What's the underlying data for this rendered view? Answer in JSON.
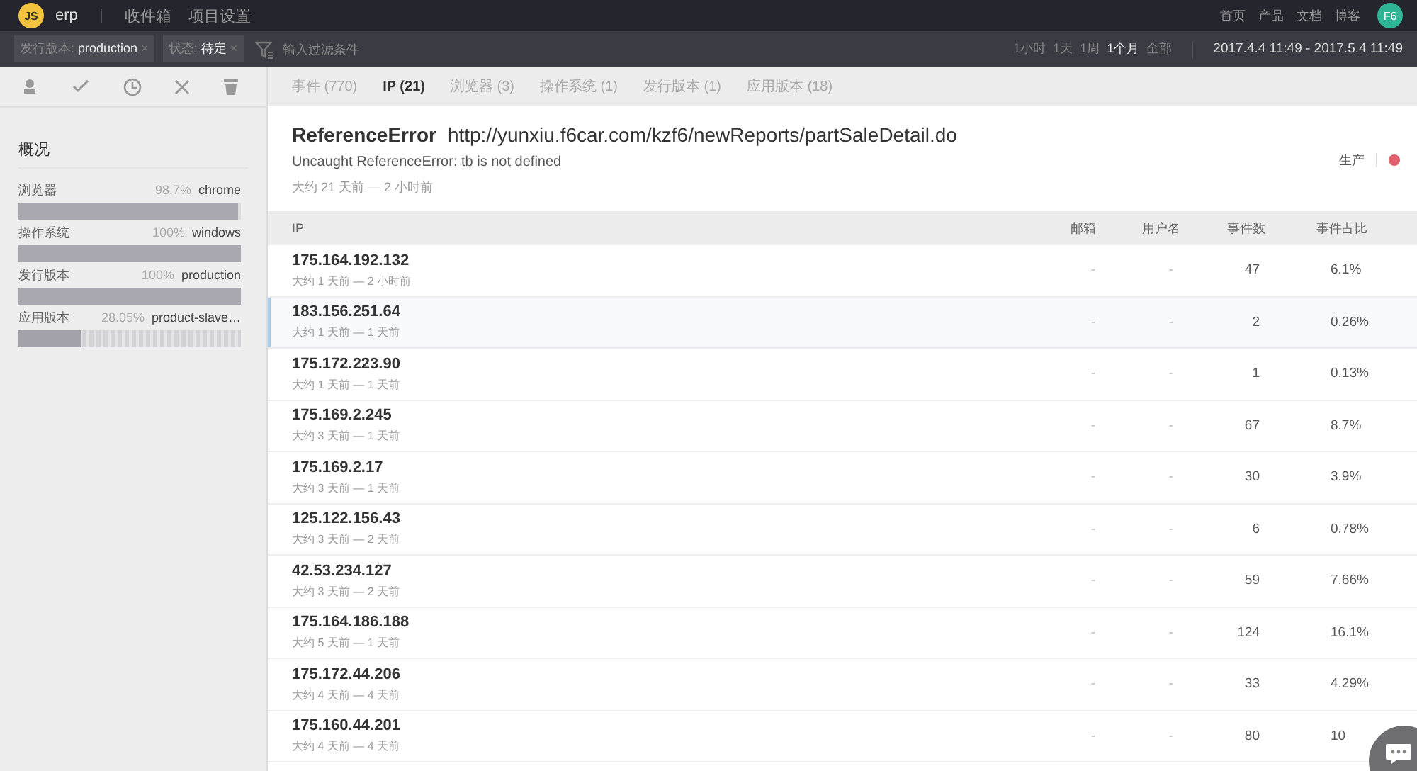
{
  "topbar": {
    "logo": "JS",
    "project": "erp",
    "nav": [
      "收件箱",
      "项目设置"
    ],
    "links": [
      "首页",
      "产品",
      "文档",
      "博客"
    ],
    "avatar": "F6"
  },
  "filterbar": {
    "chips": [
      {
        "label": "发行版本:",
        "value": "production",
        "remove": "×"
      },
      {
        "label": "状态:",
        "value": "待定",
        "remove": "×"
      }
    ],
    "placeholder": "输入过滤条件",
    "ranges": [
      {
        "label": "1小时",
        "selected": false
      },
      {
        "label": "1天",
        "selected": false
      },
      {
        "label": "1周",
        "selected": false
      },
      {
        "label": "1个月",
        "selected": true
      },
      {
        "label": "全部",
        "selected": false
      }
    ],
    "date_range": "2017.4.4 11:49 - 2017.5.4 11:49"
  },
  "sidebar": {
    "title": "概况",
    "stats": [
      {
        "name": "浏览器",
        "percent": "98.7%",
        "value": "chrome",
        "kind": "solid",
        "level": 0.987
      },
      {
        "name": "操作系统",
        "percent": "100%",
        "value": "windows",
        "kind": "solid",
        "level": 1
      },
      {
        "name": "发行版本",
        "percent": "100%",
        "value": "production",
        "kind": "solid",
        "level": 1
      },
      {
        "name": "应用版本",
        "percent": "28.05%",
        "value": "product-slave…",
        "kind": "segmented",
        "level": 0.2805
      }
    ]
  },
  "tabs": [
    {
      "label": "事件 (770)",
      "selected": false
    },
    {
      "label": "IP (21)",
      "selected": true
    },
    {
      "label": "浏览器 (3)",
      "selected": false
    },
    {
      "label": "操作系统 (1)",
      "selected": false
    },
    {
      "label": "发行版本 (1)",
      "selected": false
    },
    {
      "label": "应用版本 (18)",
      "selected": false
    }
  ],
  "issue": {
    "type": "ReferenceError",
    "url": "http://yunxiu.f6car.com/kzf6/newReports/partSaleDetail.do",
    "message": "Uncaught ReferenceError: tb is not defined",
    "time": "大约 21 天前 — 2 小时前",
    "environment": "生产",
    "color": "#e0606e"
  },
  "table": {
    "columns": [
      "IP",
      "邮箱",
      "用户名",
      "事件数",
      "事件占比"
    ],
    "rows": [
      {
        "ip": "175.164.192.132",
        "time": "大约 1 天前 — 2 小时前",
        "email": "-",
        "user": "-",
        "count": "47",
        "share": "6.1%",
        "selected": false
      },
      {
        "ip": "183.156.251.64",
        "time": "大约 1 天前 — 1 天前",
        "email": "-",
        "user": "-",
        "count": "2",
        "share": "0.26%",
        "selected": true
      },
      {
        "ip": "175.172.223.90",
        "time": "大约 1 天前 — 1 天前",
        "email": "-",
        "user": "-",
        "count": "1",
        "share": "0.13%",
        "selected": false
      },
      {
        "ip": "175.169.2.245",
        "time": "大约 3 天前 — 1 天前",
        "email": "-",
        "user": "-",
        "count": "67",
        "share": "8.7%",
        "selected": false
      },
      {
        "ip": "175.169.2.17",
        "time": "大约 3 天前 — 1 天前",
        "email": "-",
        "user": "-",
        "count": "30",
        "share": "3.9%",
        "selected": false
      },
      {
        "ip": "125.122.156.43",
        "time": "大约 3 天前 — 2 天前",
        "email": "-",
        "user": "-",
        "count": "6",
        "share": "0.78%",
        "selected": false
      },
      {
        "ip": "42.53.234.127",
        "time": "大约 3 天前 — 2 天前",
        "email": "-",
        "user": "-",
        "count": "59",
        "share": "7.66%",
        "selected": false
      },
      {
        "ip": "175.164.186.188",
        "time": "大约 5 天前 — 1 天前",
        "email": "-",
        "user": "-",
        "count": "124",
        "share": "16.1%",
        "selected": false
      },
      {
        "ip": "175.172.44.206",
        "time": "大约 4 天前 — 4 天前",
        "email": "-",
        "user": "-",
        "count": "33",
        "share": "4.29%",
        "selected": false
      },
      {
        "ip": "175.160.44.201",
        "time": "大约 4 天前 — 4 天前",
        "email": "-",
        "user": "-",
        "count": "80",
        "share": "10",
        "selected": false
      }
    ]
  }
}
